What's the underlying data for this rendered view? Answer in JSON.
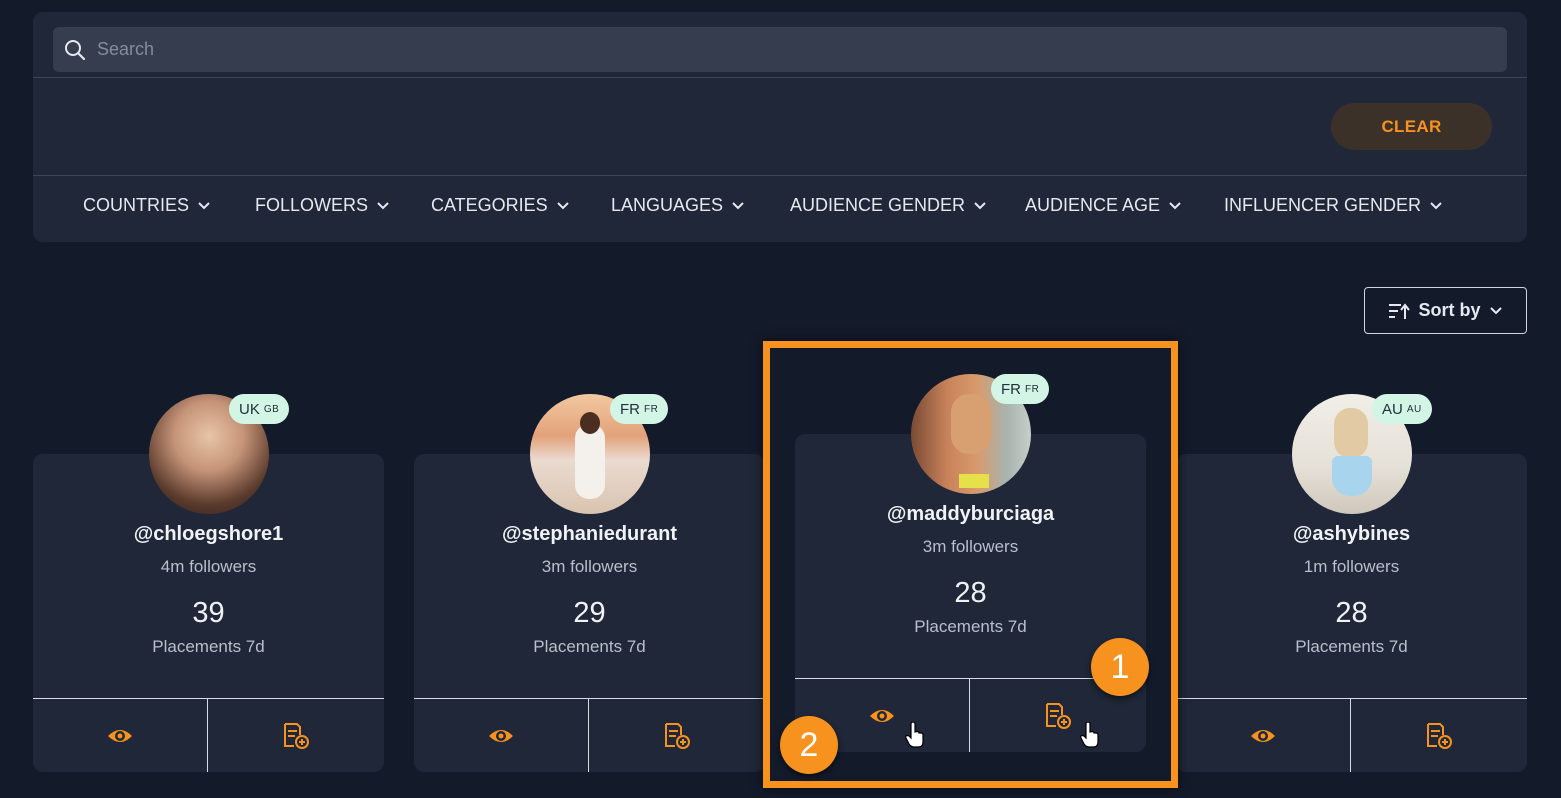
{
  "search": {
    "placeholder": "Search"
  },
  "clear_label": "CLEAR",
  "filters": [
    "COUNTRIES",
    "FOLLOWERS",
    "CATEGORIES",
    "LANGUAGES",
    "AUDIENCE GENDER",
    "AUDIENCE AGE",
    "INFLUENCER GENDER"
  ],
  "sort_label": "Sort by",
  "cards": [
    {
      "handle": "@chloegshore1",
      "followers": "4m followers",
      "placements": "39",
      "placements_label": "Placements 7d",
      "country": "UK",
      "country_code": "GB"
    },
    {
      "handle": "@stephaniedurant",
      "followers": "3m followers",
      "placements": "29",
      "placements_label": "Placements 7d",
      "country": "FR",
      "country_code": "FR"
    },
    {
      "handle": "@maddyburciaga",
      "followers": "3m followers",
      "placements": "28",
      "placements_label": "Placements 7d",
      "country": "FR",
      "country_code": "FR"
    },
    {
      "handle": "@ashybines",
      "followers": "1m followers",
      "placements": "28",
      "placements_label": "Placements 7d",
      "country": "AU",
      "country_code": "AU"
    }
  ],
  "steps": [
    "1",
    "2"
  ],
  "colors": {
    "accent": "#f7921e",
    "panel": "#1f2738",
    "background": "#131a2a",
    "badge": "#d2f5e6"
  }
}
